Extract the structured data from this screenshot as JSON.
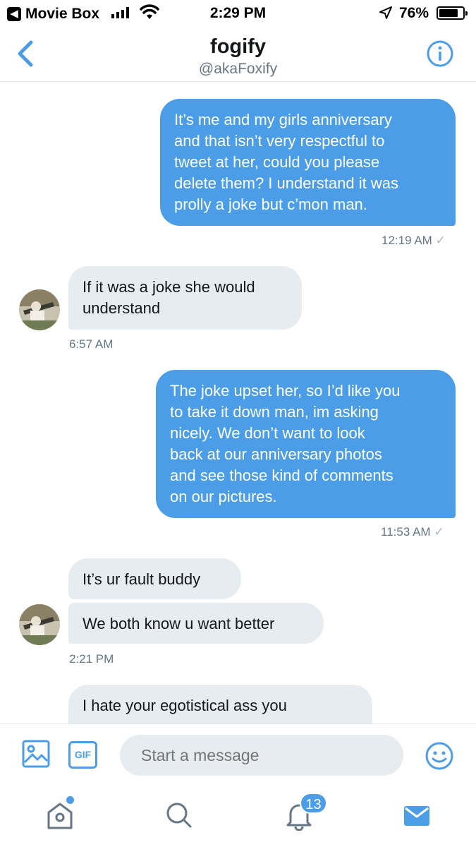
{
  "status_bar": {
    "back_app": "Movie Box",
    "time": "2:29 PM",
    "battery": "76%"
  },
  "header": {
    "title": "fogify",
    "handle": "@akaFoxify"
  },
  "messages": [
    {
      "text": "It’s me and my girls anniversary\nand that isn’t very respectful to\ntweet at her, could you please\ndelete them? I understand it was\nprolly a joke but c’mon man."
    },
    {
      "text": "If it was a joke she would\nunderstand"
    },
    {
      "text": "The joke upset her, so I’d like you\nto take it down man, im asking\nnicely. We don’t want to look\nback at our anniversary photos\nand see those kind of comments\non our pictures."
    },
    {
      "text": "It’s ur fault buddy"
    },
    {
      "text": "We both know u want better"
    },
    {
      "text": "I hate your egotistical ass you"
    }
  ],
  "timestamps": {
    "sent_1": "12:19 AM",
    "recv_1": "6:57 AM",
    "sent_2": "11:53 AM",
    "recv_2": "2:21 PM"
  },
  "composer": {
    "placeholder": "Start a message",
    "gif_label": "GIF"
  },
  "tab_bar": {
    "notifications_count": "13"
  },
  "colors": {
    "accent": "#4a9de6",
    "received_bubble": "#e6ecf0",
    "secondary_text": "#657786"
  }
}
